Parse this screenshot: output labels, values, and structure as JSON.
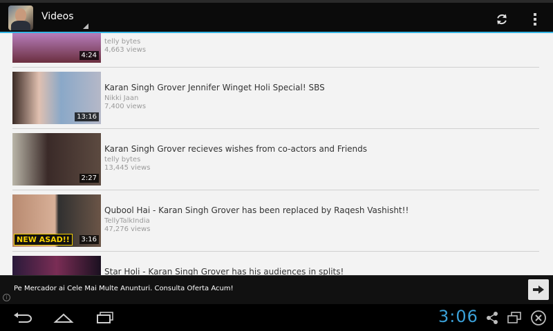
{
  "actionbar": {
    "title": "Videos"
  },
  "videos": [
    {
      "title": "",
      "channel": "telly bytes",
      "views": "4,663 views",
      "duration": "4:24"
    },
    {
      "title": "Karan Singh Grover Jennifer Winget Holi Special! SBS",
      "channel": "Nikki Jaan",
      "views": "7,400 views",
      "duration": "13:16"
    },
    {
      "title": "Karan Singh Grover recieves wishes from co-actors and Friends",
      "channel": "telly bytes",
      "views": "13,445 views",
      "duration": "2:27"
    },
    {
      "title": "Qubool Hai - Karan Singh Grover has been replaced by Raqesh Vashisht!!",
      "channel": "TellyTalkIndia",
      "views": "47,276 views",
      "duration": "3:16",
      "badge": "NEW ASAD!!"
    },
    {
      "title": "Star Holi - Karan Singh Grover has his audiences in splits!",
      "channel": "",
      "views": "",
      "duration": ""
    }
  ],
  "ad": {
    "text": "Pe Mercador ai Cele Mai Multe Anunturi. Consulta Oferta Acum!"
  },
  "navbar": {
    "clock": "3:06"
  },
  "colors": {
    "accent": "#34b5e5",
    "clock": "#3aa0d8"
  },
  "icons": [
    "refresh-icon",
    "overflow-menu-icon",
    "arrow-right-icon",
    "info-icon",
    "back-icon",
    "home-icon",
    "recents-icon",
    "share-icon",
    "window-icon",
    "close-icon"
  ]
}
